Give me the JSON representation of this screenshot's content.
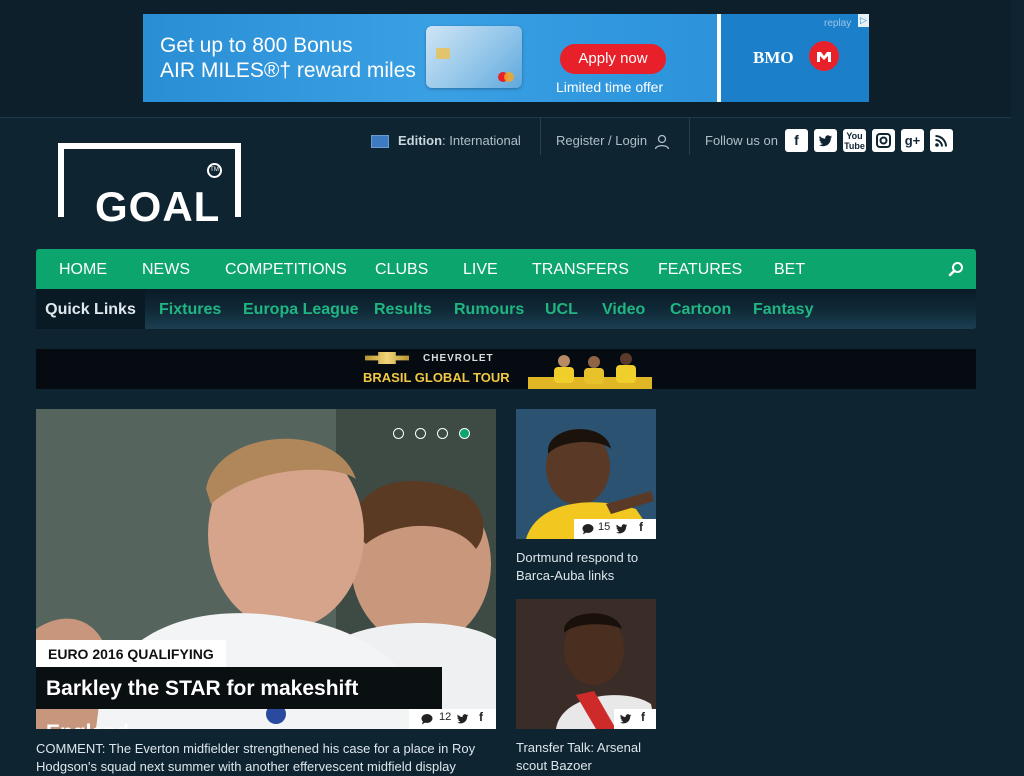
{
  "ad": {
    "line1": "Get up to 800 Bonus",
    "line2": "AIR MILES®† reward miles",
    "apply": "Apply now",
    "limited": "Limited time offer",
    "brand": "BMO",
    "replay": "replay"
  },
  "logo": "GOAL",
  "header": {
    "edition_label": "Edition",
    "edition_value": ": International",
    "register_login": "Register / Login",
    "follow_label": "Follow us on"
  },
  "social": [
    "f",
    "t",
    "yt",
    "ig",
    "g+",
    "rss"
  ],
  "nav": {
    "items": [
      "HOME",
      "NEWS",
      "COMPETITIONS",
      "CLUBS",
      "LIVE",
      "TRANSFERS",
      "FEATURES",
      "BET"
    ]
  },
  "subnav": {
    "quick": "Quick Links",
    "links": [
      "Fixtures",
      "Europa League",
      "Results",
      "Rumours",
      "UCL",
      "Video",
      "Cartoon",
      "Fantasy"
    ]
  },
  "promo": {
    "brand": "CHEVROLET",
    "tour": "BRASIL GLOBAL TOUR"
  },
  "hero": {
    "tag": "EURO 2016 QUALIFYING",
    "headline": "Barkley the STAR for makeshift England",
    "comments": "12",
    "excerpt": "COMMENT: The Everton midfielder strengthened his case for a place in Roy Hodgson's squad next summer with another effervescent midfield display"
  },
  "side": [
    {
      "comments": "15",
      "title": "Dortmund respond to Barca-Auba links"
    },
    {
      "comments": "",
      "title": "Transfer Talk: Arsenal scout Bazoer"
    }
  ],
  "colors": {
    "accent": "#0ba56d",
    "background": "#0f2431",
    "ad_red": "#e8202a"
  }
}
